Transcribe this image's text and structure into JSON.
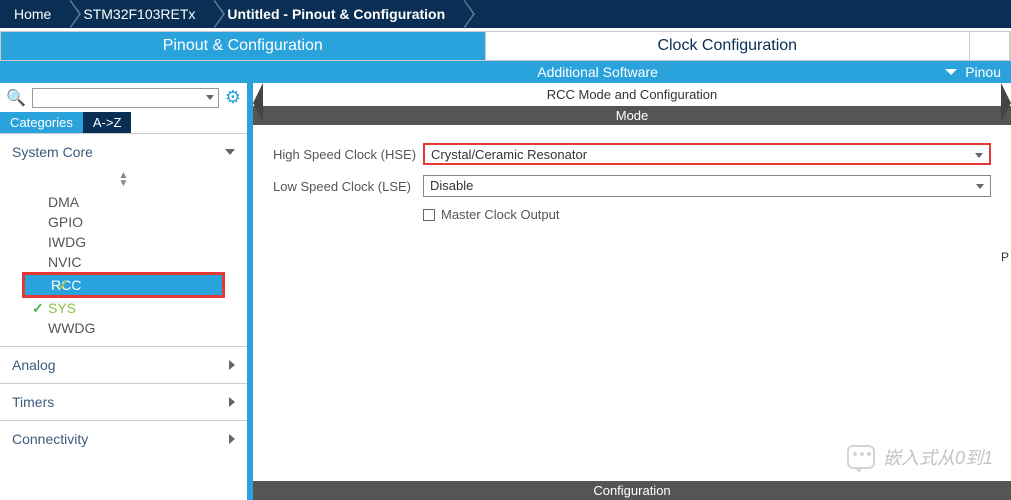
{
  "breadcrumb": {
    "home": "Home",
    "chip": "STM32F103RETx",
    "file": "Untitled - Pinout & Configuration"
  },
  "tabs": {
    "pinout": "Pinout & Configuration",
    "clock": "Clock Configuration"
  },
  "subbar": {
    "additional": "Additional Software",
    "pinout": "Pinou"
  },
  "sidebar": {
    "cat_tab": "Categories",
    "az_tab": "A->Z",
    "groups": {
      "system": "System Core",
      "analog": "Analog",
      "timers": "Timers",
      "connectivity": "Connectivity"
    },
    "items": {
      "dma": "DMA",
      "gpio": "GPIO",
      "iwdg": "IWDG",
      "nvic": "NVIC",
      "rcc": "RCC",
      "sys": "SYS",
      "wwdg": "WWDG"
    }
  },
  "panel": {
    "title": "RCC Mode and Configuration",
    "mode": "Mode",
    "configuration": "Configuration",
    "hse_label": "High Speed Clock (HSE)",
    "hse_value": "Crystal/Ceramic Resonator",
    "lse_label": "Low Speed Clock (LSE)",
    "lse_value": "Disable",
    "master_clock": "Master Clock Output"
  },
  "watermark": "嵌入式从0到1",
  "right_p": "P"
}
